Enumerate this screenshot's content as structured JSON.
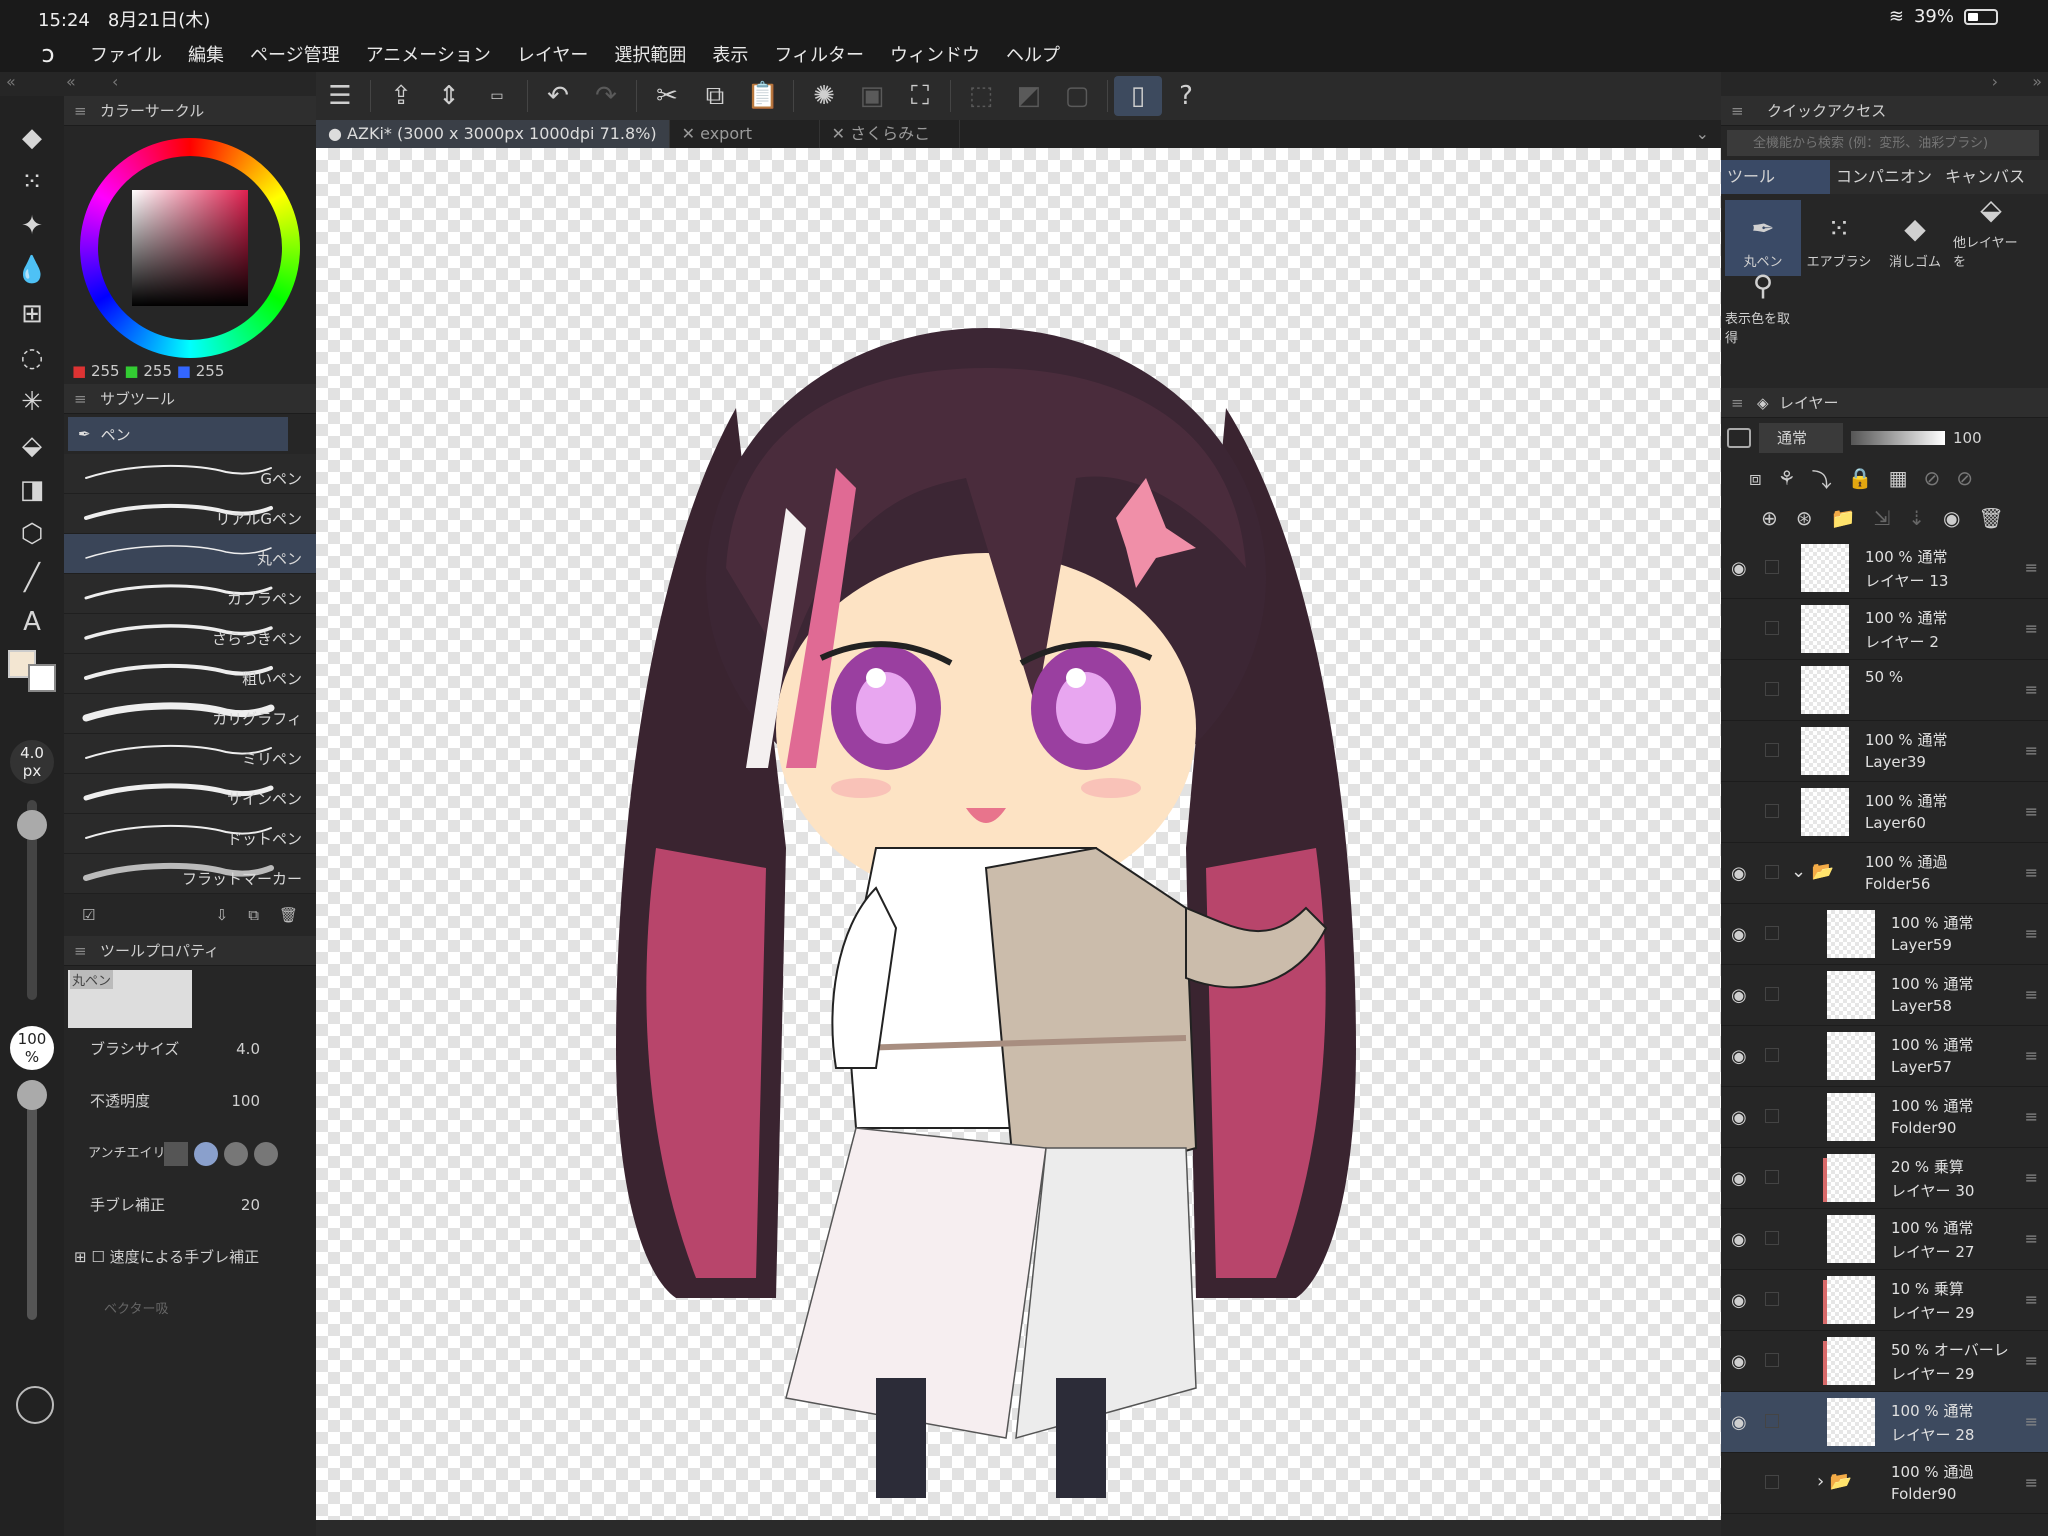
{
  "status": {
    "time": "15:24",
    "date": "8月21日(木)",
    "battery": "39%"
  },
  "menu": [
    "ファイル",
    "編集",
    "ページ管理",
    "アニメーション",
    "レイヤー",
    "選択範囲",
    "表示",
    "フィルター",
    "ウィンドウ",
    "ヘルプ"
  ],
  "tabs": [
    {
      "label": "AZKi* (3000 x 3000px 1000dpi 71.8%)",
      "active": true
    },
    {
      "label": "export",
      "active": false
    },
    {
      "label": "さくらみこ",
      "active": false
    }
  ],
  "color_panel": {
    "title": "カラーサークル",
    "r": "255",
    "g": "255",
    "b": "255"
  },
  "subtool": {
    "title": "サブツール",
    "group": "ペン",
    "brushes": [
      "Gペン",
      "リアルGペン",
      "丸ペン",
      "カブラペン",
      "さらつきペン",
      "粗いペン",
      "カリグラフィ",
      "ミリペン",
      "サインペン",
      "ドットペン",
      "フラットマーカー"
    ],
    "selected_index": 2
  },
  "tool_property": {
    "title": "ツールプロパティ",
    "preview_label": "丸ペン",
    "brush_size_label": "ブラシサイズ",
    "brush_size": "4.0",
    "opacity_label": "不透明度",
    "opacity": "100",
    "antialias_label": "アンチエイリ",
    "stabilization_label": "手ブレ補正",
    "stabilization": "20",
    "speed_stab_label": "速度による手ブレ補正",
    "vector_label": "ベクター吸"
  },
  "size_readout": {
    "value": "4.0",
    "unit": "px"
  },
  "opacity_readout": {
    "value": "100",
    "unit": "%"
  },
  "quick_access": {
    "title": "クイックアクセス",
    "search_placeholder": "全機能から検索 (例：変形、油彩ブラシ)",
    "tabs": [
      "ツール",
      "コンパニオン",
      "キャンバス"
    ],
    "tools": [
      "丸ペン",
      "エアブラシ",
      "消しゴム",
      "他レイヤーを",
      "表示色を取得"
    ]
  },
  "layer_panel": {
    "title": "レイヤー",
    "blend_mode": "通常",
    "opacity": "100",
    "layers": [
      {
        "pct": "100 %",
        "mode": "通常",
        "name": "レイヤー 13",
        "visible": true,
        "indent": 0,
        "clip": false
      },
      {
        "pct": "100 %",
        "mode": "通常",
        "name": "レイヤー 2",
        "visible": false,
        "indent": 0,
        "clip": false
      },
      {
        "pct": "50 %",
        "mode": "",
        "name": "",
        "visible": false,
        "indent": 0,
        "clip": false
      },
      {
        "pct": "100 %",
        "mode": "通常",
        "name": "Layer39",
        "visible": false,
        "indent": 0,
        "clip": false
      },
      {
        "pct": "100 %",
        "mode": "通常",
        "name": "Layer60",
        "visible": false,
        "indent": 0,
        "clip": false
      },
      {
        "pct": "100 %",
        "mode": "通過",
        "name": "Folder56",
        "visible": true,
        "indent": 0,
        "clip": false,
        "folder": true
      },
      {
        "pct": "100 %",
        "mode": "通常",
        "name": "Layer59",
        "visible": true,
        "indent": 1,
        "clip": false
      },
      {
        "pct": "100 %",
        "mode": "通常",
        "name": "Layer58",
        "visible": true,
        "indent": 1,
        "clip": false
      },
      {
        "pct": "100 %",
        "mode": "通常",
        "name": "Layer57",
        "visible": true,
        "indent": 1,
        "clip": false
      },
      {
        "pct": "100 %",
        "mode": "通常",
        "name": "Folder90",
        "visible": true,
        "indent": 1,
        "clip": false
      },
      {
        "pct": "20 %",
        "mode": "乗算",
        "name": "レイヤー 30",
        "visible": true,
        "indent": 1,
        "clip": true
      },
      {
        "pct": "100 %",
        "mode": "通常",
        "name": "レイヤー 27",
        "visible": true,
        "indent": 1,
        "clip": false
      },
      {
        "pct": "10 %",
        "mode": "乗算",
        "name": "レイヤー 29",
        "visible": true,
        "indent": 1,
        "clip": true
      },
      {
        "pct": "50 %",
        "mode": "オーバーレ",
        "name": "レイヤー 29",
        "visible": true,
        "indent": 1,
        "clip": true
      },
      {
        "pct": "100 %",
        "mode": "通常",
        "name": "レイヤー 28",
        "visible": true,
        "indent": 1,
        "clip": false,
        "selected": true
      },
      {
        "pct": "100 %",
        "mode": "通過",
        "name": "Folder90",
        "visible": false,
        "indent": 1,
        "clip": false,
        "folder": true
      }
    ]
  },
  "colors": {
    "accent": "#3a4a66",
    "selection": "#3d4a5f",
    "clip": "#d86a6a"
  }
}
